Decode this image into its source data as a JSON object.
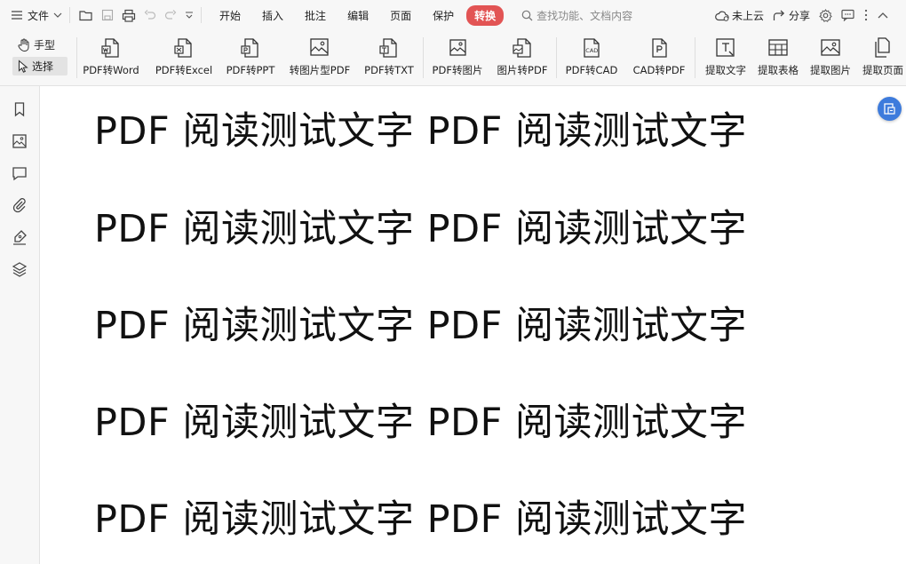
{
  "menubar": {
    "file_label": "文件",
    "tabs": [
      "开始",
      "插入",
      "批注",
      "编辑",
      "页面",
      "保护",
      "转换"
    ],
    "active_tab": "转换",
    "search_placeholder": "查找功能、文档内容",
    "cloud_label": "未上云",
    "share_label": "分享"
  },
  "ribbon": {
    "hand_tool": "手型",
    "select_tool": "选择",
    "buttons": [
      {
        "label": "PDF转Word",
        "icon": "pdf-to-word-icon"
      },
      {
        "label": "PDF转Excel",
        "icon": "pdf-to-excel-icon"
      },
      {
        "label": "PDF转PPT",
        "icon": "pdf-to-ppt-icon"
      },
      {
        "label": "转图片型PDF",
        "icon": "to-image-pdf-icon"
      },
      {
        "label": "PDF转TXT",
        "icon": "pdf-to-txt-icon"
      },
      {
        "label": "PDF转图片",
        "icon": "pdf-to-image-icon"
      },
      {
        "label": "图片转PDF",
        "icon": "image-to-pdf-icon"
      },
      {
        "label": "PDF转CAD",
        "icon": "pdf-to-cad-icon"
      },
      {
        "label": "CAD转PDF",
        "icon": "cad-to-pdf-icon"
      },
      {
        "label": "提取文字",
        "icon": "extract-text-icon"
      },
      {
        "label": "提取表格",
        "icon": "extract-table-icon"
      },
      {
        "label": "提取图片",
        "icon": "extract-image-icon"
      },
      {
        "label": "提取页面",
        "icon": "extract-page-icon"
      }
    ]
  },
  "sidebar": {
    "icons": [
      "bookmark-icon",
      "image-icon",
      "comment-icon",
      "attachment-icon",
      "signature-icon",
      "layers-icon"
    ]
  },
  "document": {
    "lines": [
      "PDF 阅读测试文字 PDF 阅读测试文字",
      "PDF 阅读测试文字 PDF 阅读测试文字",
      "PDF 阅读测试文字 PDF 阅读测试文字",
      "PDF 阅读测试文字 PDF 阅读测试文字",
      "PDF 阅读测试文字 PDF 阅读测试文字"
    ]
  },
  "colors": {
    "active_tab_bg": "#e25454",
    "float_button": "#3d7bdc"
  }
}
